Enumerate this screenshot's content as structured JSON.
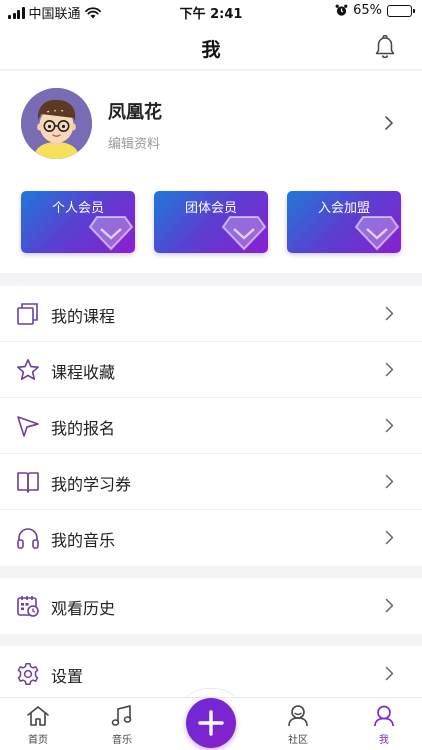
{
  "status_bar": {
    "carrier": "中国联通",
    "time": "下午 2:41",
    "battery": "65%",
    "battery_level": 0.65
  },
  "nav": {
    "title": "我"
  },
  "profile": {
    "name": "凤凰花",
    "edit_label": "编辑资料"
  },
  "member_cards": [
    {
      "label": "个人会员"
    },
    {
      "label": "团体会员"
    },
    {
      "label": "入会加盟"
    }
  ],
  "menu_group_1": [
    {
      "label": "我的课程",
      "icon": "book-icon"
    },
    {
      "label": "课程收藏",
      "icon": "star-icon"
    },
    {
      "label": "我的报名",
      "icon": "paper-plane-icon"
    },
    {
      "label": "我的学习券",
      "icon": "open-book-icon"
    },
    {
      "label": "我的音乐",
      "icon": "headphones-icon"
    }
  ],
  "menu_group_2": [
    {
      "label": "观看历史",
      "icon": "calendar-clock-icon"
    }
  ],
  "menu_group_3": [
    {
      "label": "设置",
      "icon": "gear-icon"
    }
  ],
  "tab_bar": [
    {
      "label": "首页",
      "icon": "home-icon"
    },
    {
      "label": "音乐",
      "icon": "music-note-icon"
    },
    {
      "label": "社区",
      "icon": "community-icon"
    },
    {
      "label": "我",
      "icon": "user-icon",
      "active": true
    }
  ],
  "colors": {
    "accent": "#7a2bd0",
    "card_gradient": [
      "#1f79d9",
      "#8b1fd0"
    ],
    "icon": "#6b3fa0"
  }
}
